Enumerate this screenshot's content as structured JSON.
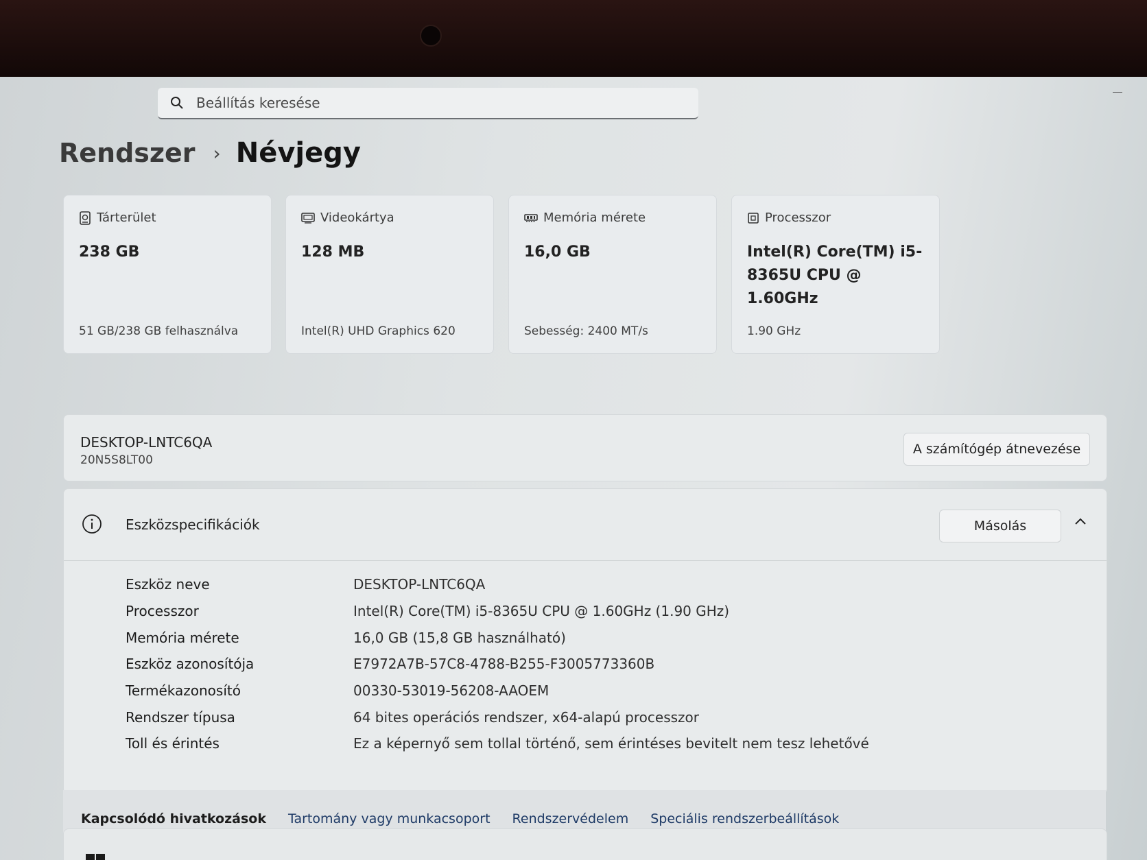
{
  "search": {
    "placeholder": "Beállítás keresése"
  },
  "breadcrumb": {
    "parent": "Rendszer",
    "separator": "›",
    "current": "Névjegy"
  },
  "cards": [
    {
      "icon": "drive-icon",
      "label": "Tárterület",
      "value": "238 GB",
      "sub": "51 GB/238 GB felhasználva"
    },
    {
      "icon": "display-card-icon",
      "label": "Videokártya",
      "value": "128 MB",
      "sub": "Intel(R) UHD Graphics 620"
    },
    {
      "icon": "memory-icon",
      "label": "Memória mérete",
      "value": "16,0 GB",
      "sub": "Sebesség: 2400 MT/s"
    },
    {
      "icon": "processor-icon",
      "label": "Processzor",
      "value": "Intel(R) Core(TM) i5-8365U CPU @ 1.60GHz",
      "sub": "1.90 GHz"
    }
  ],
  "device": {
    "name": "DESKTOP-LNTC6QA",
    "model": "20N5S8LT00",
    "rename_label": "A számítógép átnevezése"
  },
  "specs": {
    "title": "Eszközspecifikációk",
    "copy_label": "Másolás",
    "rows": [
      {
        "key": "Eszköz neve",
        "value": "DESKTOP-LNTC6QA"
      },
      {
        "key": "Processzor",
        "value": "Intel(R) Core(TM) i5-8365U CPU @ 1.60GHz (1.90 GHz)"
      },
      {
        "key": "Memória mérete",
        "value": "16,0 GB (15,8 GB használható)"
      },
      {
        "key": "Eszköz azonosítója",
        "value": "E7972A7B-57C8-4788-B255-F3005773360B"
      },
      {
        "key": "Termékazonosító",
        "value": "00330-53019-56208-AAOEM"
      },
      {
        "key": "Rendszer típusa",
        "value": "64 bites operációs rendszer, x64-alapú processzor"
      },
      {
        "key": "Toll és érintés",
        "value": "Ez a képernyő sem tollal történő, sem érintéses bevitelt nem tesz lehetővé"
      }
    ]
  },
  "related": {
    "label": "Kapcsolódó hivatkozások",
    "links": [
      "Tartomány vagy munkacsoport",
      "Rendszervédelem",
      "Speciális rendszerbeállítások"
    ]
  }
}
